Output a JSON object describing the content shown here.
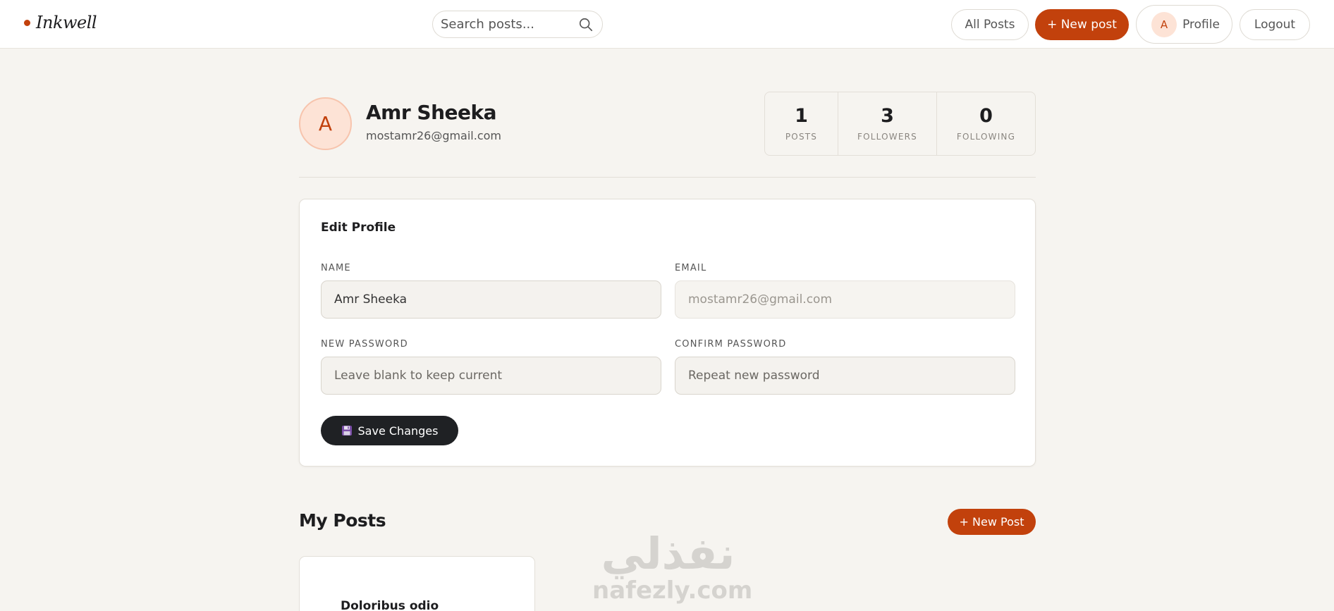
{
  "brand": {
    "name": "Inkwell"
  },
  "search": {
    "placeholder": "Search posts..."
  },
  "nav": {
    "all_posts": "All Posts",
    "new_post": "+ New post",
    "profile_initial": "A",
    "profile": "Profile",
    "logout": "Logout"
  },
  "profile": {
    "initial": "A",
    "name": "Amr Sheeka",
    "email": "mostamr26@gmail.com",
    "stats": [
      {
        "value": "1",
        "label": "POSTS"
      },
      {
        "value": "3",
        "label": "FOLLOWERS"
      },
      {
        "value": "0",
        "label": "FOLLOWING"
      }
    ]
  },
  "edit_profile": {
    "title": "Edit Profile",
    "name_label": "NAME",
    "name_value": "Amr Sheeka",
    "email_label": "EMAIL",
    "email_value": "mostamr26@gmail.com",
    "new_password_label": "NEW PASSWORD",
    "new_password_placeholder": "Leave blank to keep current",
    "confirm_password_label": "CONFIRM PASSWORD",
    "confirm_password_placeholder": "Repeat new password",
    "save_label": "Save Changes",
    "save_icon": "floppy-disk-icon"
  },
  "my_posts": {
    "title": "My Posts",
    "new_post": "+ New Post",
    "posts": [
      {
        "title": "Doloribus odio"
      }
    ]
  },
  "watermark": {
    "arabic": "نفذلي",
    "latin": "nafezly.com"
  },
  "colors": {
    "accent": "#c2410c",
    "background": "#f6f4f0",
    "dark_button": "#1f2124"
  }
}
